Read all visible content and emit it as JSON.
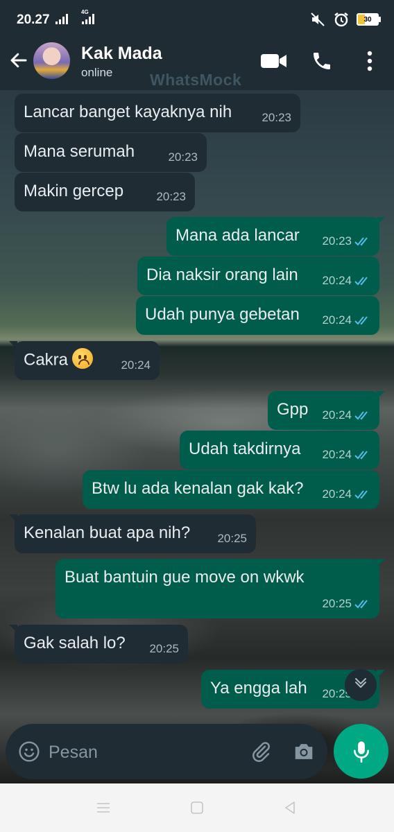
{
  "status_bar": {
    "time": "20.27",
    "network": "4G",
    "battery": "30"
  },
  "header": {
    "contact_name": "Kak Mada",
    "contact_status": "online",
    "watermark": "WhatsMock"
  },
  "messages": [
    {
      "dir": "in",
      "text": "Lancar banget kayaknya nih",
      "time": "20:23"
    },
    {
      "dir": "in",
      "text": "Mana serumah",
      "time": "20:23"
    },
    {
      "dir": "in",
      "text": "Makin gercep",
      "time": "20:23"
    },
    {
      "dir": "out",
      "text": "Mana ada lancar",
      "time": "20:23",
      "read": true
    },
    {
      "dir": "out",
      "text": "Dia naksir orang lain",
      "time": "20:24",
      "read": true
    },
    {
      "dir": "out",
      "text": "Udah punya gebetan",
      "time": "20:24",
      "read": true
    },
    {
      "dir": "in",
      "text": "Cakra",
      "emoji": "frowning-face",
      "time": "20:24"
    },
    {
      "dir": "out",
      "text": "Gpp",
      "time": "20:24",
      "read": true
    },
    {
      "dir": "out",
      "text": "Udah takdirnya",
      "time": "20:24",
      "read": true
    },
    {
      "dir": "out",
      "text": "Btw lu ada kenalan gak kak?",
      "time": "20:24",
      "read": true
    },
    {
      "dir": "in",
      "text": "Kenalan buat apa nih?",
      "time": "20:25"
    },
    {
      "dir": "out",
      "text": "Buat bantuin gue move on wkwk",
      "time": "20:25",
      "read": true
    },
    {
      "dir": "in",
      "text": "Gak salah lo?",
      "time": "20:25"
    },
    {
      "dir": "out",
      "text": "Ya engga lah",
      "time": "20:25",
      "read": true
    }
  ],
  "composer": {
    "placeholder": "Pesan"
  },
  "colors": {
    "header_bg": "#1f2c34",
    "incoming_bubble": "#1f2c34",
    "outgoing_bubble": "#005c4b",
    "accent": "#00a884",
    "read_tick": "#53bdeb"
  }
}
